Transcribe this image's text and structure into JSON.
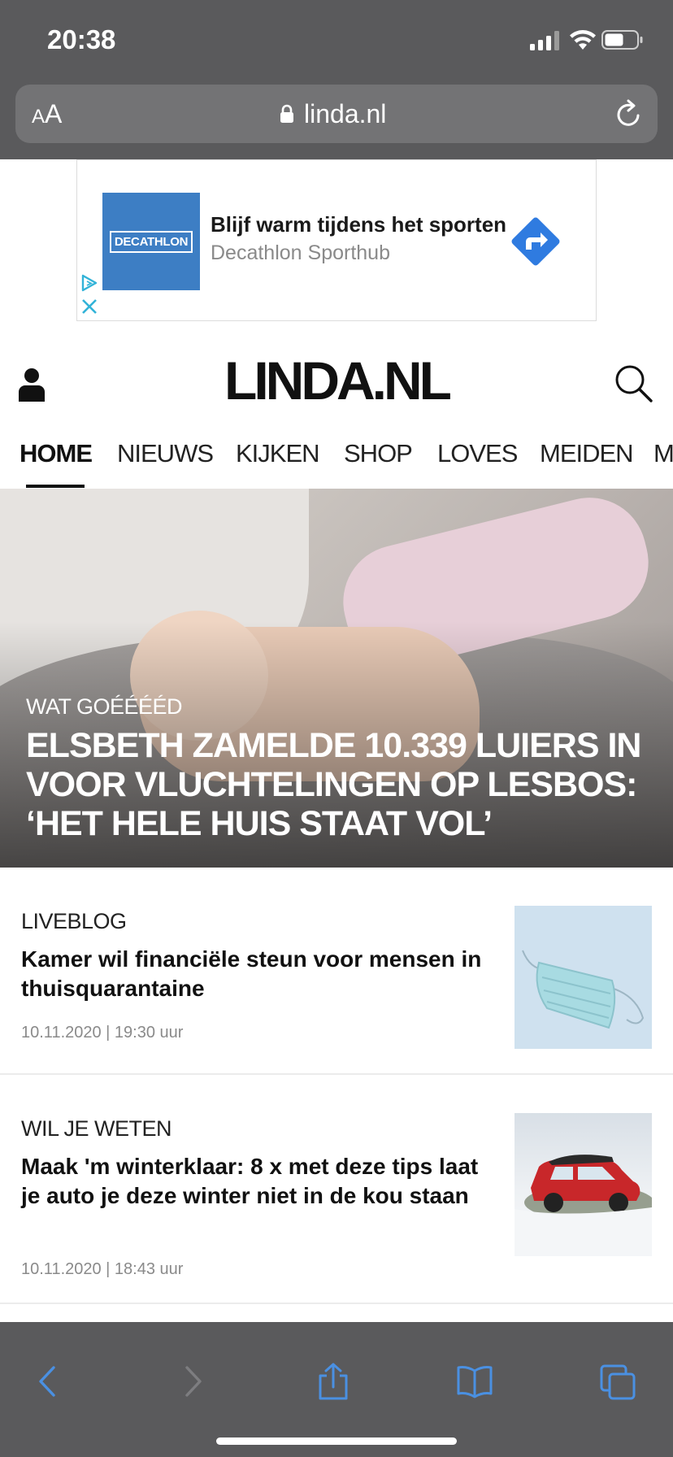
{
  "status": {
    "time": "20:38"
  },
  "browser": {
    "text_size_small": "A",
    "text_size_large": "A",
    "url": "linda.nl"
  },
  "ad": {
    "brand": "DECATHLON",
    "title": "Blijf warm tijdens het sporten",
    "subtitle": "Decathlon Sporthub",
    "colors": {
      "brand": "#3d7ec4",
      "cta": "#2f7be0"
    }
  },
  "site": {
    "logo": "LINDA.NL"
  },
  "nav": {
    "items": [
      "HOME",
      "NIEUWS",
      "KIJKEN",
      "SHOP",
      "LOVES",
      "MEIDEN",
      "M"
    ]
  },
  "hero": {
    "kicker": "WAT GOÉÉÉÉD",
    "title": "ELSBETH ZAMELDE 10.339 LUIERS IN VOOR VLUCHTELINGEN OP LESBOS: ‘HET HELE HUIS STAAT VOL’"
  },
  "articles": [
    {
      "kicker": "LIVEBLOG",
      "title": "Kamer wil financiële steun voor mensen in thuisquarantaine",
      "date": "10.11.2020 | 19:30 uur",
      "thumb": "face-mask"
    },
    {
      "kicker": "WIL JE WETEN",
      "title": "Maak 'm winterklaar: 8 x met deze tips laat je auto je deze winter niet in de kou staan",
      "date": "10.11.2020 | 18:43 uur",
      "thumb": "red-car-in-snow"
    }
  ],
  "toolbar": {
    "icons": [
      "back-icon",
      "forward-icon",
      "share-icon",
      "bookmarks-icon",
      "tabs-icon"
    ],
    "accent": "#4a90e2"
  }
}
